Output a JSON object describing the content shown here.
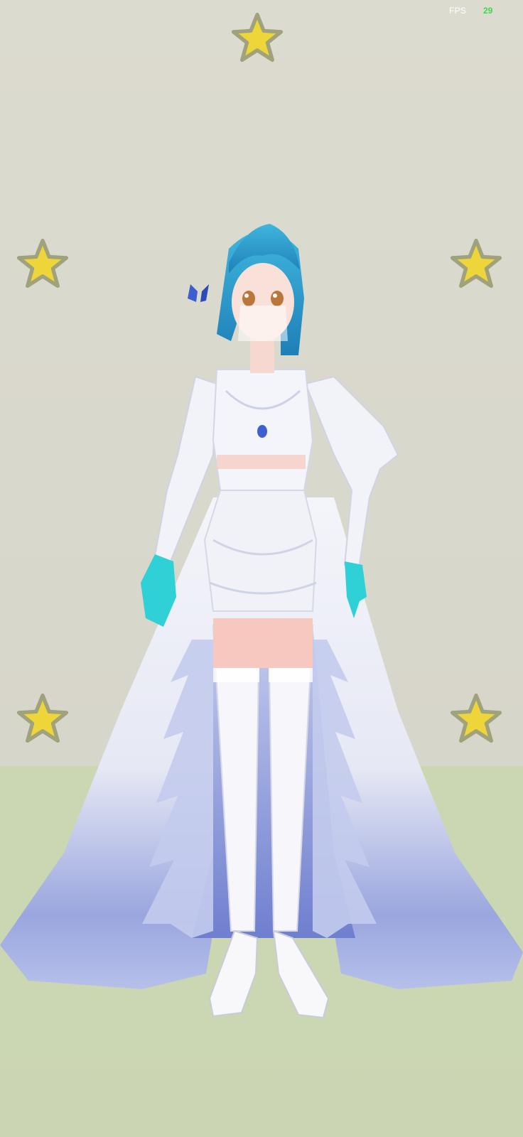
{
  "hud": {
    "fps_label": "FPS",
    "fps_value": "29"
  },
  "scene": {
    "character": "anime-girl-avatar",
    "stars": [
      "star-icon",
      "star-icon",
      "star-icon",
      "star-icon",
      "star-icon"
    ],
    "colors": {
      "wall": "#dcdbcf",
      "floor": "#cbd7b3",
      "star_fill": "#eed63a",
      "star_glow": "#9fa27a",
      "hair": "#2fa6cf",
      "gloves": "#2fd0d6",
      "dress": "#f2f3f8",
      "dress_shadow": "#7f8fd6",
      "fps_value": "#3ddc4a"
    }
  }
}
